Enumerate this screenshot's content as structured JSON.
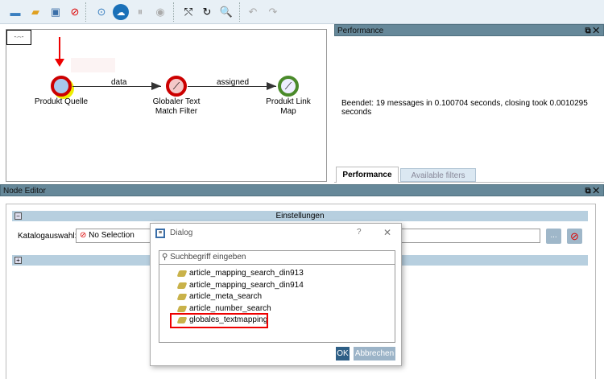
{
  "toolbar": {
    "buttons": [
      "open-folder",
      "open-file",
      "save",
      "stop-red",
      "play",
      "cloud",
      "pause",
      "stop",
      "graph-layout",
      "refresh",
      "zoom-select",
      "undo",
      "redo"
    ]
  },
  "canvas": {
    "nodes": [
      {
        "label": "Produkt Quelle"
      },
      {
        "label1": "Globaler Text",
        "label2": "Match Filter"
      },
      {
        "label1": "Produkt Link",
        "label2": "Map"
      }
    ],
    "edges": [
      "data",
      "assigned"
    ]
  },
  "performance": {
    "title": "Performance",
    "message": "Beendet: 19 messages in 0.100704 seconds, closing took 0.0010295 seconds",
    "tabs": [
      "Performance",
      "Available filters"
    ]
  },
  "node_editor": {
    "title": "Node Editor",
    "section": "Einstellungen",
    "field_label": "Katalogauswahl:",
    "field_value": "No Selection",
    "browse_label": "..."
  },
  "dialog": {
    "title": "Dialog",
    "help": "?",
    "close": "✕",
    "search_placeholder": "Suchbegriff eingeben",
    "items": [
      "article_mapping_search_din913",
      "article_mapping_search_din914",
      "article_meta_search",
      "article_number_search",
      "globales_textmapping"
    ],
    "ok": "OK",
    "cancel": "Abbrechen"
  },
  "colors": {
    "header": "#668899",
    "highlight": "#e00000"
  }
}
